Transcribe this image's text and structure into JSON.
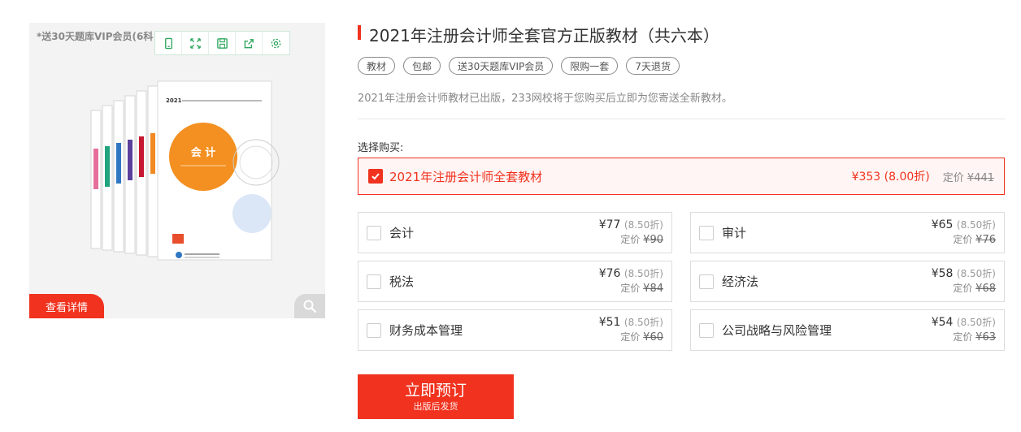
{
  "image_panel": {
    "promo_text": "*送30天题库VIP会员(6科",
    "toolbar_icons": [
      "tablet-icon",
      "expand-icon",
      "save-icon",
      "share-icon",
      "settings-icon"
    ],
    "book_cover_text": "会 计",
    "book_year": "2021",
    "details_label": "查看详情",
    "zoom_icon": "search-icon"
  },
  "product": {
    "title": "2021年注册会计师全套官方正版教材（共六本）",
    "tags": [
      "教材",
      "包邮",
      "送30天题库VIP会员",
      "限购一套",
      "7天退货"
    ],
    "description": "2021年注册会计师教材已出版，233网校将于您购买后立即为您寄送全新教材。"
  },
  "purchase": {
    "label": "选择购买:",
    "bundle": {
      "name": "2021年注册会计师全套教材",
      "price": "¥353 (8.00折)",
      "list_label": "定价",
      "list_price": "¥441",
      "checked": true
    },
    "options": [
      {
        "name": "会计",
        "price": "¥77",
        "discount": "(8.50折)",
        "list_label": "定价",
        "list_price": "¥90"
      },
      {
        "name": "审计",
        "price": "¥65",
        "discount": "(8.50折)",
        "list_label": "定价",
        "list_price": "¥76"
      },
      {
        "name": "税法",
        "price": "¥76",
        "discount": "(8.50折)",
        "list_label": "定价",
        "list_price": "¥84"
      },
      {
        "name": "经济法",
        "price": "¥58",
        "discount": "(8.50折)",
        "list_label": "定价",
        "list_price": "¥68"
      },
      {
        "name": "财务成本管理",
        "price": "¥51",
        "discount": "(8.50折)",
        "list_label": "定价",
        "list_price": "¥60"
      },
      {
        "name": "公司战略与风险管理",
        "price": "¥54",
        "discount": "(8.50折)",
        "list_label": "定价",
        "list_price": "¥63"
      }
    ]
  },
  "order_button": {
    "label": "立即预订",
    "sub_label": "出版后发货"
  },
  "colors": {
    "accent": "#f0321e",
    "toolbar_icon": "#2aa55a"
  }
}
